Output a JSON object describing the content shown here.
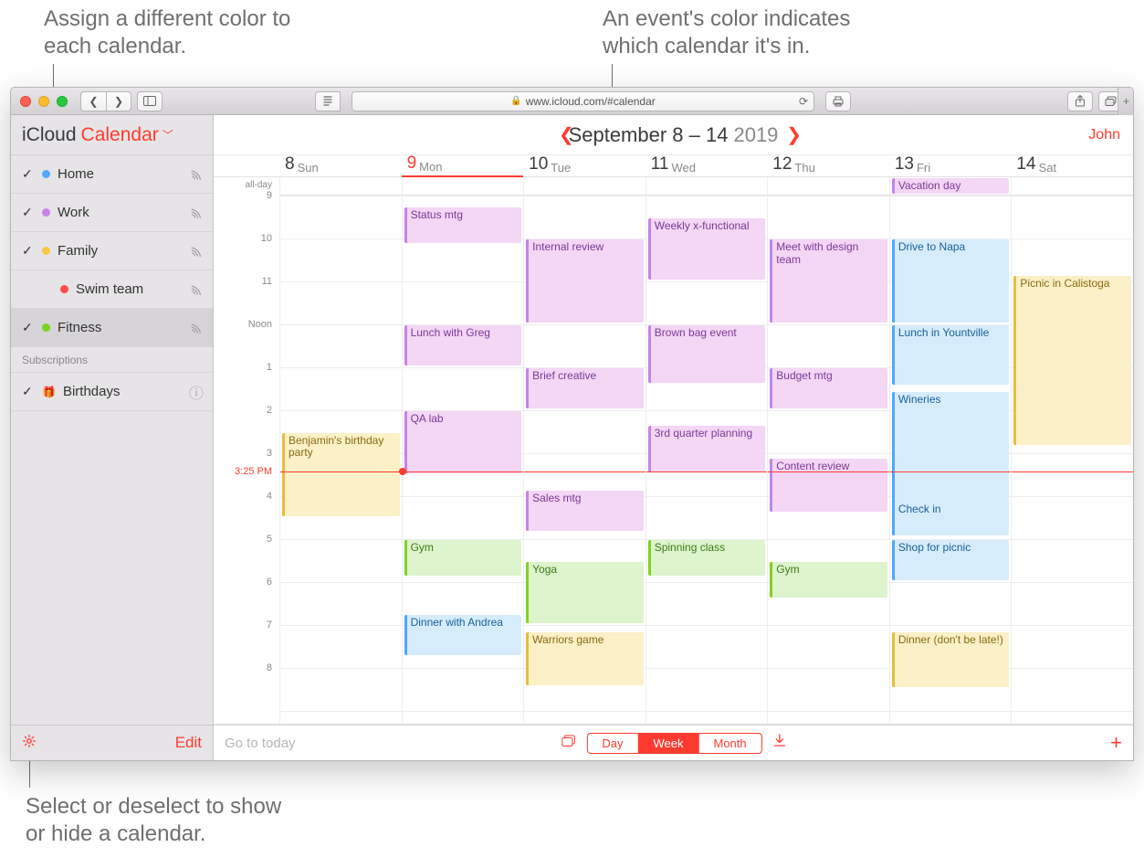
{
  "annotations": {
    "topLeft": "Assign a different color to\neach calendar.",
    "topRight": "An event's color indicates\nwhich calendar it's in.",
    "bottom": "Select or deselect to show\nor hide a calendar."
  },
  "chrome": {
    "url": "www.icloud.com/#calendar"
  },
  "header": {
    "brand1": "iCloud",
    "brand2": "Calendar"
  },
  "sidebar": {
    "calendars": [
      {
        "name": "Home",
        "color": "#4fa8ff",
        "checked": true,
        "shared": true
      },
      {
        "name": "Work",
        "color": "#c583e8",
        "checked": true,
        "shared": true
      },
      {
        "name": "Family",
        "color": "#f7c845",
        "checked": true,
        "shared": true
      },
      {
        "name": "Swim team",
        "color": "#ff4e4a",
        "checked": false,
        "shared": true,
        "indent": true
      },
      {
        "name": "Fitness",
        "color": "#7ed321",
        "checked": true,
        "shared": true,
        "selected": true
      }
    ],
    "subs_label": "Subscriptions",
    "subs": [
      {
        "name": "Birthdays",
        "checked": true
      }
    ],
    "edit": "Edit"
  },
  "main": {
    "range": "September 8 – 14",
    "year": "2019",
    "user": "John",
    "goto": "Go to today",
    "seg": [
      "Day",
      "Week",
      "Month"
    ],
    "seg_active": 1,
    "days": [
      {
        "num": "8",
        "name": "Sun"
      },
      {
        "num": "9",
        "name": "Mon",
        "today": true
      },
      {
        "num": "10",
        "name": "Tue"
      },
      {
        "num": "11",
        "name": "Wed"
      },
      {
        "num": "12",
        "name": "Thu"
      },
      {
        "num": "13",
        "name": "Fri"
      },
      {
        "num": "14",
        "name": "Sat"
      }
    ],
    "allday_label": "all-day",
    "hours": [
      "9",
      "10",
      "11",
      "Noon",
      "1",
      "2",
      "3",
      "4",
      "5",
      "6",
      "7",
      "8"
    ],
    "now_label": "3:25 PM",
    "now_hour_offset": 6.42,
    "allday_events": [
      {
        "day": 5,
        "title": "Vacation day",
        "cal": "work"
      }
    ],
    "events": [
      {
        "day": 0,
        "start": 5.5,
        "dur": 2.0,
        "title": "Benjamin's birthday party",
        "cal": "family"
      },
      {
        "day": 1,
        "start": 0.25,
        "dur": 0.9,
        "title": "Status mtg",
        "cal": "work"
      },
      {
        "day": 1,
        "start": 3.0,
        "dur": 1.0,
        "title": "Lunch with Greg",
        "cal": "work"
      },
      {
        "day": 1,
        "start": 5.0,
        "dur": 1.5,
        "title": "QA lab",
        "cal": "work"
      },
      {
        "day": 1,
        "start": 8.0,
        "dur": 0.9,
        "title": "Gym",
        "cal": "fitness"
      },
      {
        "day": 1,
        "start": 9.75,
        "dur": 1.0,
        "title": "Dinner with Andrea",
        "cal": "home"
      },
      {
        "day": 2,
        "start": 1.0,
        "dur": 2.0,
        "title": "Internal review",
        "cal": "work"
      },
      {
        "day": 2,
        "start": 4.0,
        "dur": 1.0,
        "title": "Brief creative",
        "cal": "work"
      },
      {
        "day": 2,
        "start": 6.85,
        "dur": 1.0,
        "title": "Sales mtg",
        "cal": "work"
      },
      {
        "day": 2,
        "start": 8.5,
        "dur": 1.5,
        "title": "Yoga",
        "cal": "fitness"
      },
      {
        "day": 2,
        "start": 10.15,
        "dur": 1.3,
        "title": "Warriors game",
        "cal": "family"
      },
      {
        "day": 3,
        "start": 0.5,
        "dur": 1.5,
        "title": "Weekly x-functional",
        "cal": "work"
      },
      {
        "day": 3,
        "start": 3.0,
        "dur": 1.4,
        "title": "Brown bag event",
        "cal": "work"
      },
      {
        "day": 3,
        "start": 5.35,
        "dur": 1.15,
        "title": "3rd quarter planning",
        "cal": "work"
      },
      {
        "day": 3,
        "start": 8.0,
        "dur": 0.9,
        "title": "Spinning class",
        "cal": "fitness"
      },
      {
        "day": 4,
        "start": 1.0,
        "dur": 2.0,
        "title": "Meet with design team",
        "cal": "work"
      },
      {
        "day": 4,
        "start": 4.0,
        "dur": 1.0,
        "title": "Budget mtg",
        "cal": "work"
      },
      {
        "day": 4,
        "start": 6.1,
        "dur": 1.3,
        "title": "Content review",
        "cal": "work"
      },
      {
        "day": 4,
        "start": 8.5,
        "dur": 0.9,
        "title": "Gym",
        "cal": "fitness"
      },
      {
        "day": 5,
        "start": 1.0,
        "dur": 2.0,
        "title": "Drive to Napa",
        "cal": "home"
      },
      {
        "day": 5,
        "start": 3.0,
        "dur": 1.45,
        "title": "Lunch in Yountville",
        "cal": "home"
      },
      {
        "day": 5,
        "start": 4.55,
        "dur": 2.7,
        "title": "Wineries",
        "cal": "home"
      },
      {
        "day": 5,
        "start": 7.1,
        "dur": 0.85,
        "title": "Check in",
        "cal": "home"
      },
      {
        "day": 5,
        "start": 8.0,
        "dur": 1.0,
        "title": "Shop for picnic",
        "cal": "home"
      },
      {
        "day": 5,
        "start": 10.15,
        "dur": 1.35,
        "title": "Dinner (don't be late!)",
        "cal": "family"
      },
      {
        "day": 6,
        "start": 1.85,
        "dur": 4.0,
        "title": "Picnic in Calistoga",
        "cal": "family"
      }
    ],
    "cal_colors": {
      "work": {
        "bg": "#f4d6f5",
        "bd": "#c583e8",
        "tx": "#7a3a96"
      },
      "home": {
        "bg": "#d7ecfb",
        "bd": "#4fa8ff",
        "tx": "#18619b"
      },
      "family": {
        "bg": "#fbf0c7",
        "bd": "#e8bd3f",
        "tx": "#8a6a12"
      },
      "fitness": {
        "bg": "#ddf4cd",
        "bd": "#7ed321",
        "tx": "#3d7a17"
      }
    }
  }
}
